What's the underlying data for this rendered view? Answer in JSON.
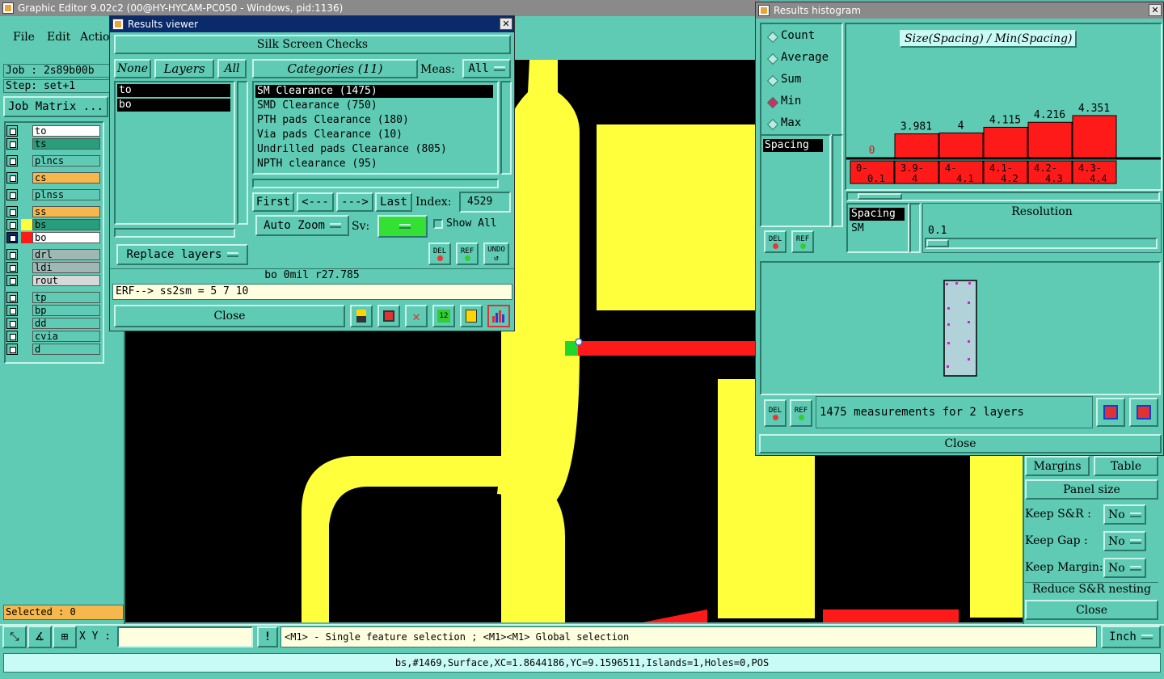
{
  "app": {
    "title": "Graphic Editor 9.02c2 (00@HY-HYCAM-PC050 - Windows, pid:1136)",
    "menu": [
      "File",
      "Edit",
      "Actio"
    ],
    "job": "Job : 2s89b00b",
    "step": "Step: set+1",
    "job_matrix": "Job Matrix ...",
    "layers": [
      {
        "name": "to",
        "bg": "#ffffff"
      },
      {
        "name": "ts",
        "bg": "#2a9e7c"
      },
      {
        "name": "plncs",
        "bg": "#5fcbb4"
      },
      {
        "name": "cs",
        "bg": "#f6b84d"
      },
      {
        "name": "plnss",
        "bg": "#5fcbb4"
      },
      {
        "name": "ss",
        "bg": "#f6b84d"
      },
      {
        "name": "bs",
        "bg": "#2a9e7c"
      },
      {
        "name": "bo",
        "bg": "#ffffff"
      },
      {
        "name": "drl",
        "bg": "#9fb8b4"
      },
      {
        "name": "ldi",
        "bg": "#9fb8b4"
      },
      {
        "name": "rout",
        "bg": "#d8d8d8"
      },
      {
        "name": "tp",
        "bg": "#5fcbb4"
      },
      {
        "name": "bp",
        "bg": "#5fcbb4"
      },
      {
        "name": "dd",
        "bg": "#5fcbb4"
      },
      {
        "name": "cvia",
        "bg": "#5fcbb4"
      },
      {
        "name": "d",
        "bg": "#5fcbb4"
      }
    ],
    "selected": "Selected : 0",
    "xy_label": "X Y :",
    "hint": "<M1> - Single feature selection ; <M1><M1> Global selection",
    "units": "Inch",
    "status": "bs,#1469,Surface,XC=1.8644186,YC=9.1596511,Islands=1,Holes=0,POS",
    "right_panel": {
      "margins": "Margins",
      "table": "Table",
      "panel_size": "Panel size",
      "keep_sr": "Keep S&R :",
      "keep_gap": "Keep Gap :",
      "keep_margin": "Keep Margin:",
      "no": "No",
      "reduce": "Reduce S&R nesting",
      "close": "Close"
    }
  },
  "results_viewer": {
    "title": "Results viewer",
    "header": "Silk Screen Checks",
    "none": "None",
    "layers_label": "Layers",
    "all": "All",
    "categories_label": "Categories (11)",
    "meas_label": "Meas:",
    "meas_value": "All",
    "layer_items": [
      "to",
      "bo"
    ],
    "categories": [
      "SM Clearance (1475)",
      "SMD Clearance (750)",
      "PTH pads Clearance (180)",
      "Via pads Clearance (10)",
      "Undrilled pads Clearance (805)",
      "NPTH clearance (95)"
    ],
    "first": "First",
    "prev": "<---",
    "next": "--->",
    "last": "Last",
    "index_label": "Index:",
    "index_value": "4529",
    "auto_zoom": "Auto Zoom",
    "sv_label": "Sv:",
    "show_all": "Show All",
    "replace_layers": "Replace layers",
    "del": "DEL",
    "ref": "REF",
    "undo": "UNDO",
    "info": "bo 0mil r27.785",
    "erf": "ERF--> ss2sm = 5 7 10",
    "close": "Close"
  },
  "histogram": {
    "title": "Results histogram",
    "chart_title": "Size(Spacing) / Min(Spacing)",
    "modes": [
      "Count",
      "Average",
      "Sum",
      "Min",
      "Max"
    ],
    "selected_mode": "Min",
    "spacing_list": [
      "Spacing"
    ],
    "attr_list": [
      "Spacing",
      "SM"
    ],
    "resolution_label": "Resolution",
    "resolution_value": "0.1",
    "measurements": "1475 measurements for 2 layers",
    "close": "Close",
    "del": "DEL",
    "ref": "REF"
  },
  "chart_data": {
    "type": "bar",
    "title": "Size(Spacing) / Min(Spacing)",
    "categories": [
      "0-0.1",
      "3.9-4",
      "4-4.1",
      "4.1-4.2",
      "4.2-4.3",
      "4.3-4.4"
    ],
    "values": [
      0,
      3.981,
      4,
      4.115,
      4.216,
      4.351
    ],
    "value_labels": [
      "0",
      "3.981",
      "4",
      "4.115",
      "4.216",
      "4.351"
    ],
    "bin_labels": [
      [
        "0-",
        "0.1"
      ],
      [
        "3.9-",
        "4"
      ],
      [
        "4-",
        "4.1"
      ],
      [
        "4.1-",
        "4.2"
      ],
      [
        "4.2-",
        "4.3"
      ],
      [
        "4.3-",
        "4.4"
      ]
    ],
    "bar_color": "#ff1a1a"
  }
}
